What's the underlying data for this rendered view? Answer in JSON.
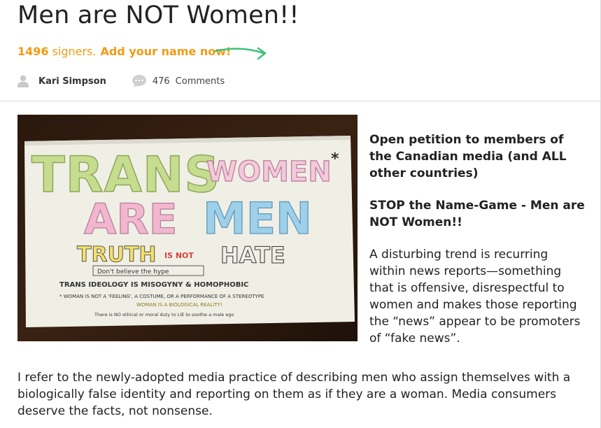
{
  "header": {
    "title": "Men are NOT Women!!",
    "signers_count": "1496",
    "signers_label": "signers.",
    "add_name": "Add your name now!",
    "arrow_icon": "curved-arrow-right-icon",
    "accent_color": "#f29b14",
    "arrow_color": "#3cc27a"
  },
  "meta": {
    "author": "Kari Simpson",
    "author_icon": "user-icon",
    "comment_count": "476",
    "comment_label": "Comments",
    "comment_icon": "speech-bubble-icon"
  },
  "sign": {
    "line1": "TRANS",
    "line1b": "WOMEN",
    "asterisk": "*",
    "line2a": "ARE",
    "line2b": "MEN",
    "truth": "TRUTH",
    "is_not": "IS NOT",
    "hate": "HATE",
    "dont_believe": "Don't believe the hype",
    "trans_ideology": "TRANS IDEOLOGY IS MISOGYNY & HOMOPHOBIC",
    "woman_line": "* WOMAN IS NOT A 'FEELING', A COSTUME, OR A PERFORMANCE OF A STEREOTYPE",
    "woman_line2": "WOMAN IS A BIOLOGICAL REALITY!",
    "bottom_line": "There is NO ethical or moral duty to LIE to soothe a male ego"
  },
  "side": {
    "heading1": "Open petition to members of the Canadian media (and ALL other countries)",
    "heading2": "STOP the Name-Game - Men are NOT Women!!",
    "paragraph": "A disturbing trend is recurring within news reports—something that is offensive, disrespectful to women and makes those reporting the “news” appear to be promoters of “fake news”."
  },
  "body": {
    "paragraph": "I refer to the newly-adopted media practice of describing men who assign themselves with a biologically false identity and reporting on them as if they are a woman. Media consumers deserve the facts, not nonsense."
  }
}
